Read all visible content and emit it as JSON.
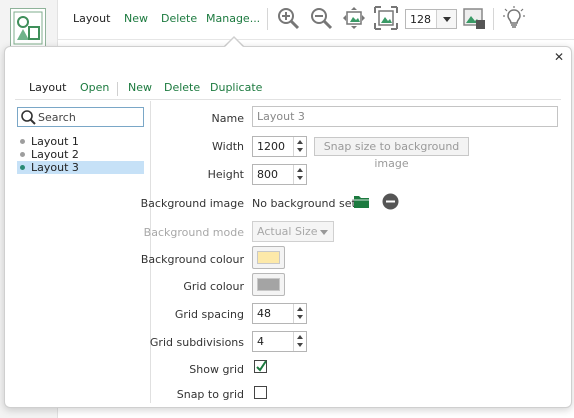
{
  "toolbar": {
    "layout_label": "Layout",
    "new_label": "New",
    "delete_label": "Delete",
    "manage_label": "Manage...",
    "zoom_value": "128",
    "icons": [
      "zoom-in-icon",
      "zoom-out-icon",
      "fit-view-icon",
      "fit-image-icon",
      "background-image-icon",
      "lightbulb-icon"
    ]
  },
  "popup": {
    "tabs": {
      "layout": "Layout",
      "open": "Open",
      "new": "New",
      "delete": "Delete",
      "duplicate": "Duplicate"
    },
    "search": {
      "placeholder": "Search",
      "value": ""
    },
    "layouts": [
      {
        "label": "Layout 1",
        "selected": false
      },
      {
        "label": "Layout 2",
        "selected": false
      },
      {
        "label": "Layout 3",
        "selected": true
      }
    ],
    "form": {
      "name": {
        "label": "Name",
        "value": "Layout 3"
      },
      "width": {
        "label": "Width",
        "value": "1200"
      },
      "snap_button": "Snap size to background image",
      "height": {
        "label": "Height",
        "value": "800"
      },
      "background_image": {
        "label": "Background image",
        "value": "No background set"
      },
      "background_mode": {
        "label": "Background mode",
        "value": "Actual Size"
      },
      "background_colour": {
        "label": "Background colour",
        "color": "#fde9a9"
      },
      "grid_colour": {
        "label": "Grid colour",
        "color": "#a4a4a4"
      },
      "grid_spacing": {
        "label": "Grid spacing",
        "value": "48"
      },
      "grid_subdivisions": {
        "label": "Grid subdivisions",
        "value": "4"
      },
      "show_grid": {
        "label": "Show grid",
        "checked": true
      },
      "snap_to_grid": {
        "label": "Snap to grid",
        "checked": false
      }
    }
  },
  "colors": {
    "accent_green": "#1c7a3f",
    "selection": "#c6e1f7"
  }
}
